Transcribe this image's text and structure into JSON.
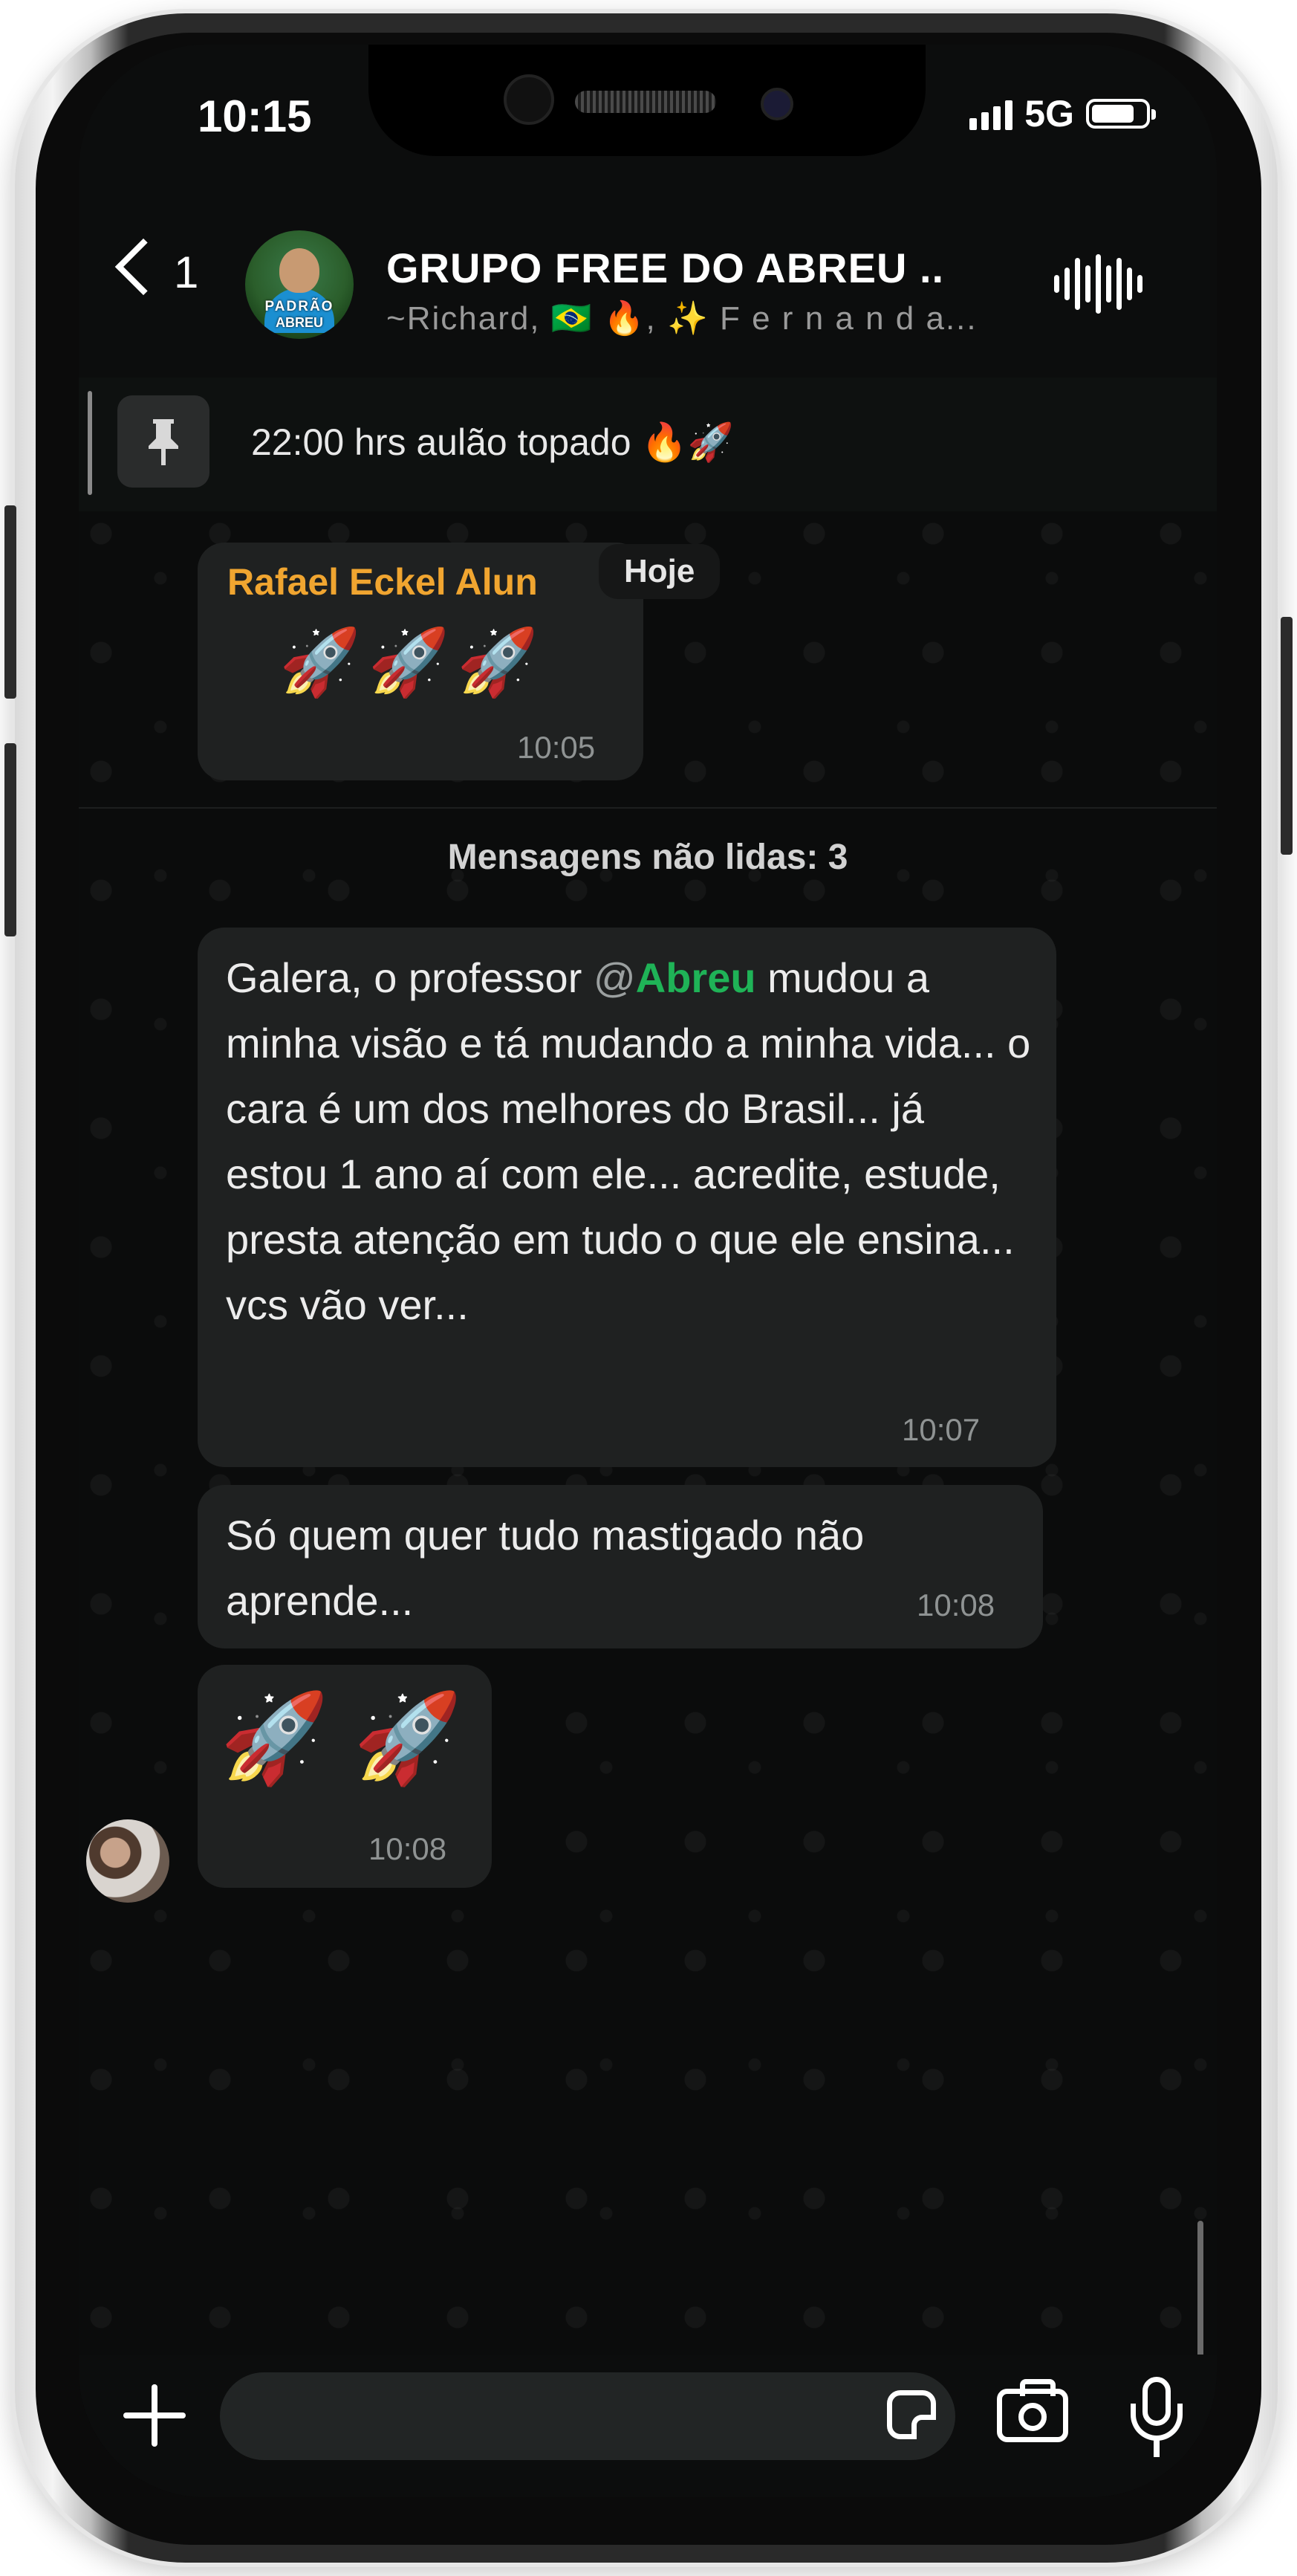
{
  "status_bar": {
    "time": "10:15",
    "network": "5G"
  },
  "header": {
    "back_count": "1",
    "avatar_text_top": "PADRÃO",
    "avatar_text_bottom": "ABREU",
    "group_name": "GRUPO FREE DO ABREU ..",
    "members": "~Richard, 🇧🇷 🔥, ✨ F e r n a n d a..."
  },
  "pinned": {
    "text": "22:00 hrs aulão topado 🔥🚀"
  },
  "messages": [
    {
      "sender": "Rafael Eckel Alun",
      "content": "🚀🚀🚀",
      "time": "10:05"
    },
    {
      "mention_at": "@",
      "mention": "Abreu",
      "prefix": "Galera, o professor ",
      "suffix": "mudou a minha visão e tá mudando a minha vida... o cara é um dos melhores do Brasil... já estou 1 ano aí com ele... acredite, estude, presta atenção em tudo o que ele ensina... vcs vão ver...",
      "time": "10:07"
    },
    {
      "content": "Só quem quer tudo mastigado não aprende...",
      "time": "10:08"
    },
    {
      "content": "🚀 🚀",
      "time": "10:08"
    }
  ],
  "date_pill": "Hoje",
  "unread_divider": "Mensagens não lidas: 3",
  "input": {
    "placeholder": ""
  },
  "icons": [
    "back-icon",
    "voice-wave-icon",
    "pin-icon",
    "plus-icon",
    "sticker-icon",
    "camera-icon",
    "mic-icon"
  ]
}
